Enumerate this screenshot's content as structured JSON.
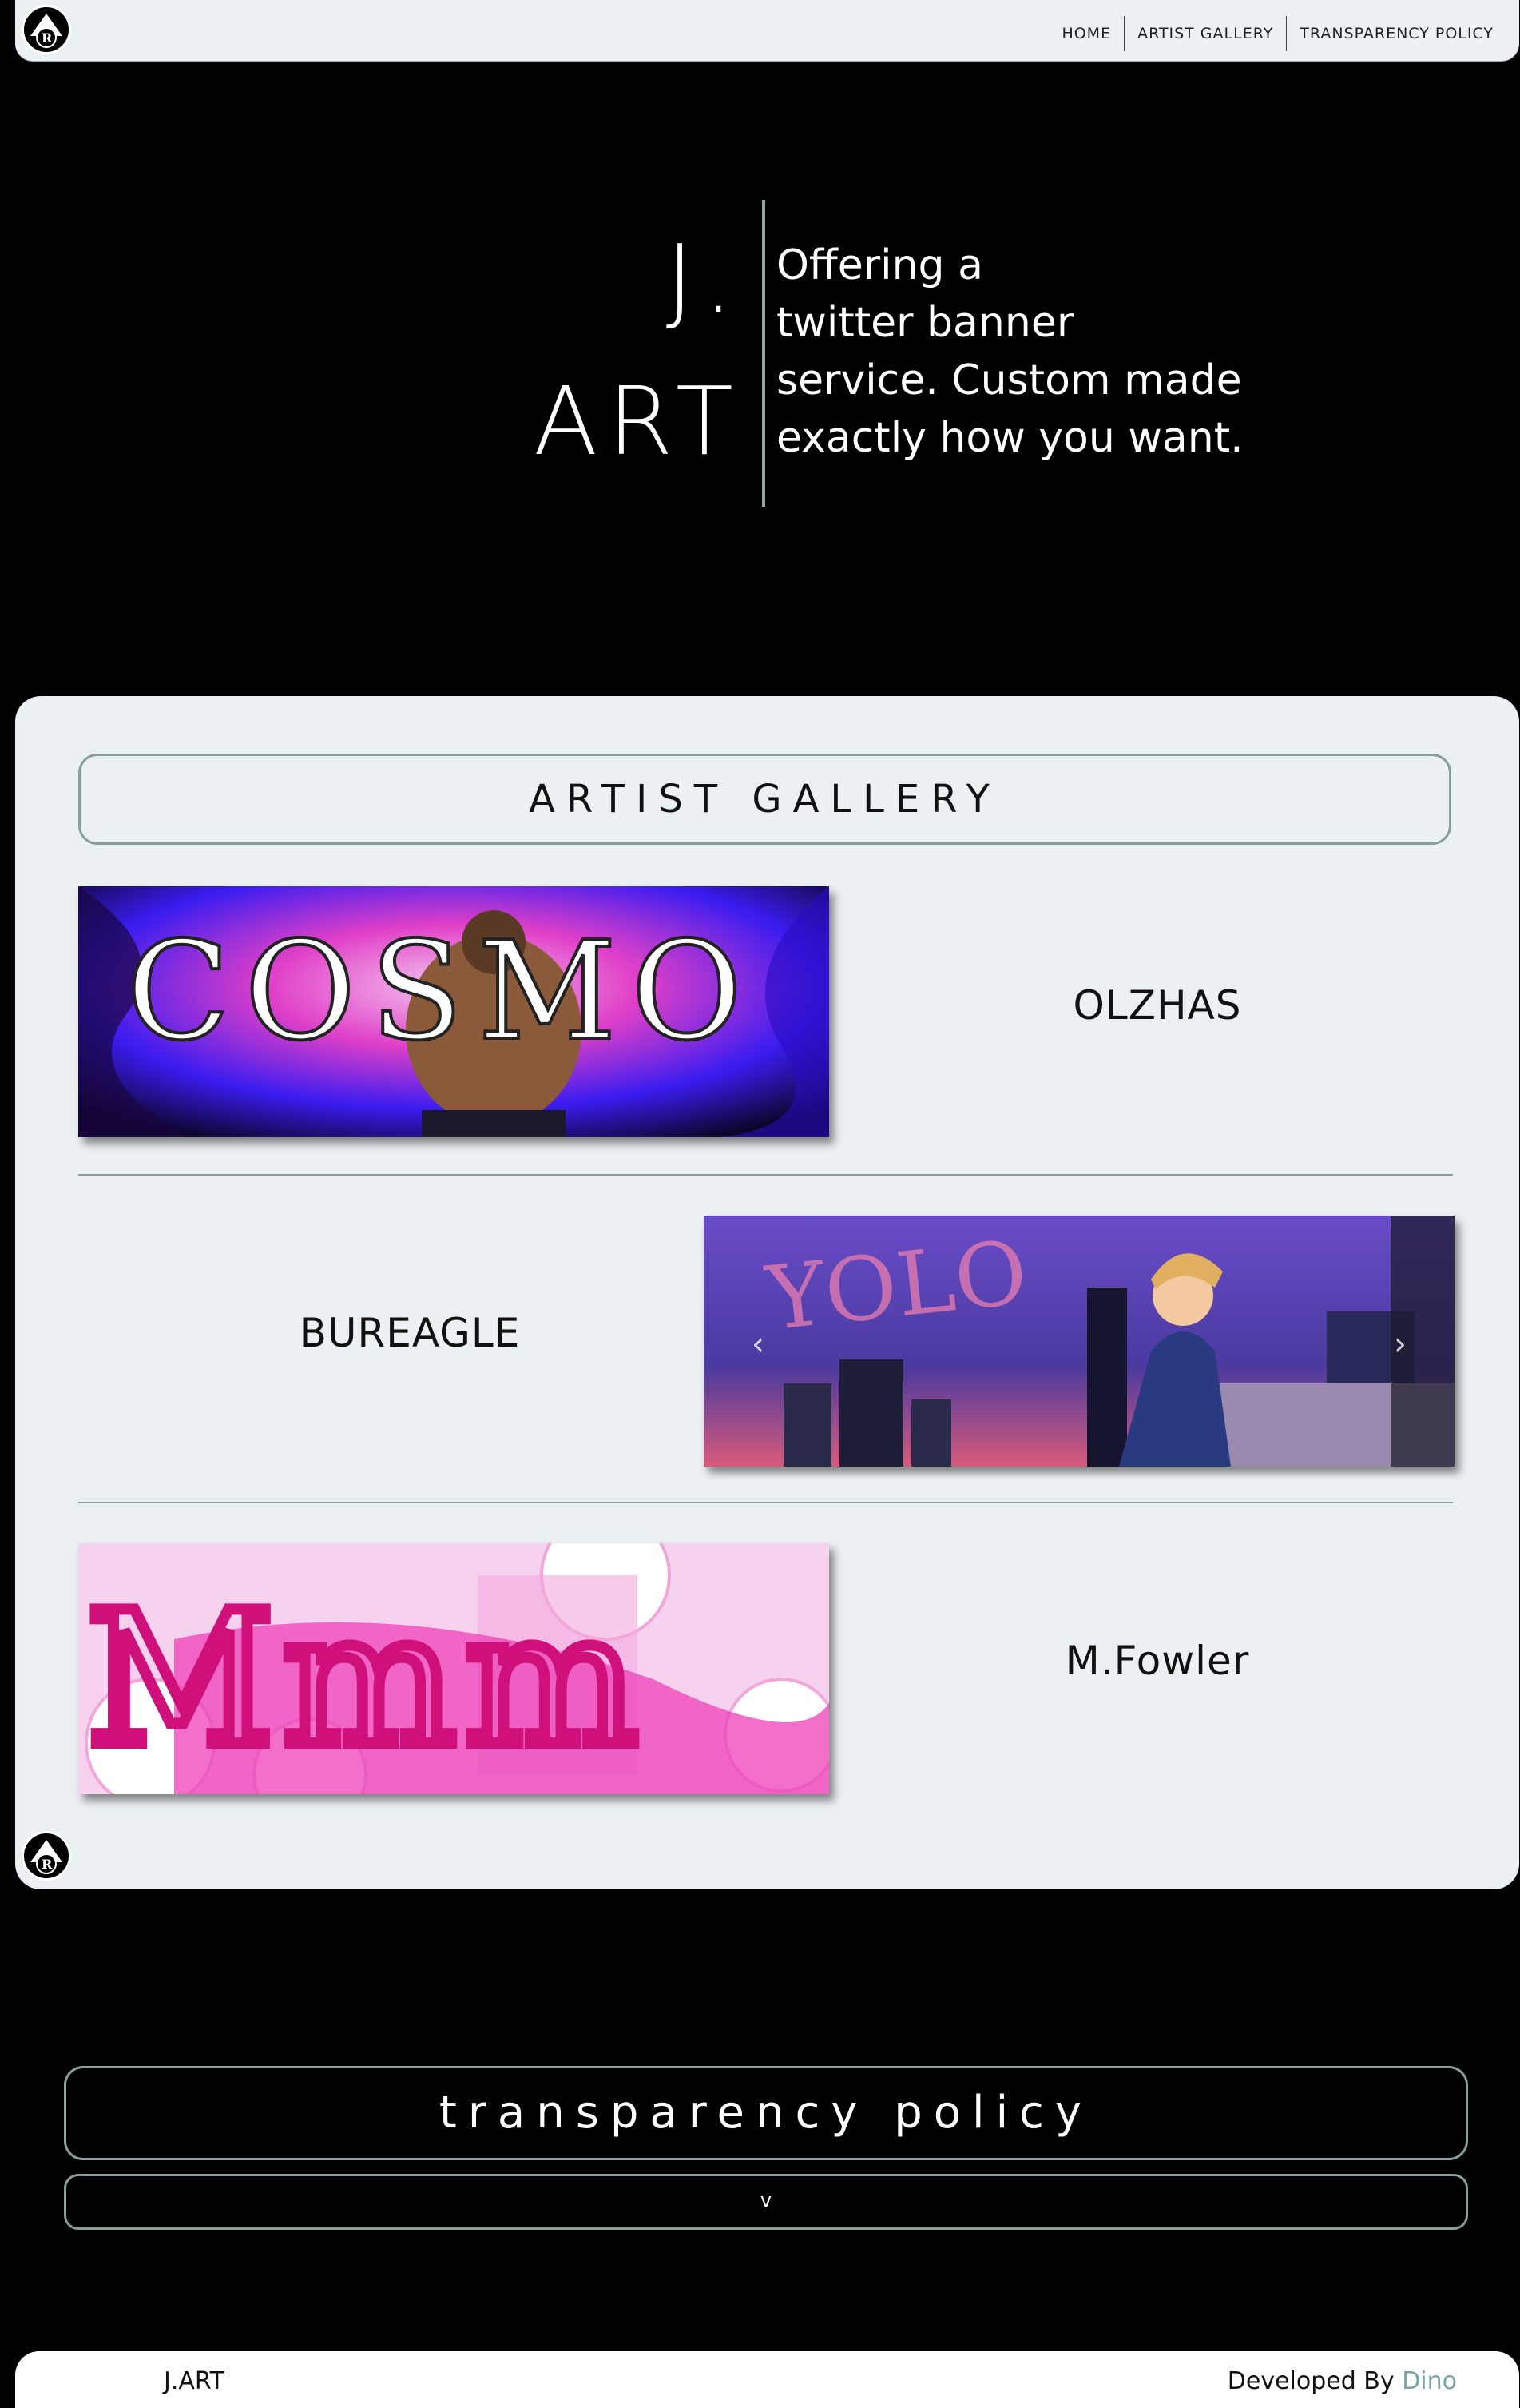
{
  "nav": {
    "logo_icon": "jr-logo-icon",
    "links": [
      "HOME",
      "ARTIST GALLERY",
      "TRANSPARENCY POLICY"
    ]
  },
  "hero": {
    "title_line1": "J.",
    "title_line2": "ART",
    "tagline": [
      "Offering a",
      "twitter banner",
      "service. Custom made",
      "exactly how you want."
    ]
  },
  "gallery": {
    "title": "ARTIST GALLERY",
    "items": [
      {
        "artist": "OLZHAS",
        "banner_text": "COSMO"
      },
      {
        "artist": "BUREAGLE",
        "banner_text": "YOLO",
        "has_carousel_arrows": true
      },
      {
        "artist": "M.Fowler",
        "banner_text": "Mmm"
      }
    ]
  },
  "policy": {
    "title": "transparency policy",
    "toggle_icon": "chevron-down-icon",
    "toggle_glyph": "v"
  },
  "footer": {
    "brand": "J.ART",
    "developed_by": "Developed By ",
    "developer": "Dino"
  },
  "colors": {
    "background": "#000000",
    "panel": "#ebf0f2",
    "accent_border": "#879f9b",
    "developer_link": "#7aa5a5"
  }
}
